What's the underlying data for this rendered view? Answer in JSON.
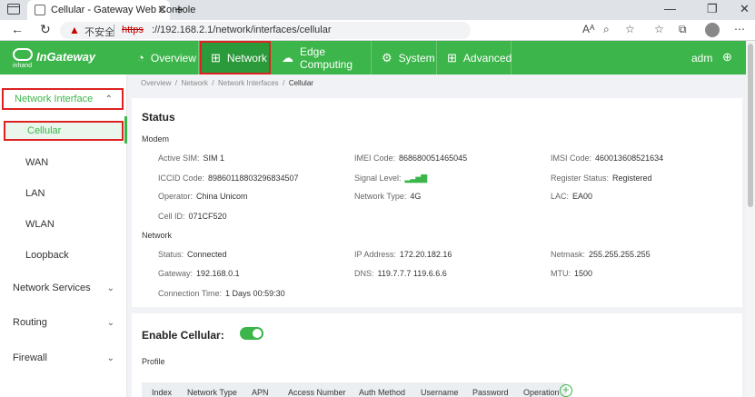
{
  "browser": {
    "tab_title": "Cellular - Gateway Web Console",
    "tab_close": "✕",
    "new_tab": "+",
    "insecure_label": "不安全",
    "url_protocol": "https",
    "url_rest": "://192.168.2.1/network/interfaces/cellular",
    "read_aloud_label": "Aᴬ"
  },
  "header": {
    "brand": "InGateway",
    "brand_sub": "inhand",
    "nav": [
      {
        "label": "Overview",
        "icon": "dashboard-icon"
      },
      {
        "label": "Network",
        "icon": "network-icon"
      },
      {
        "label": "Edge Computing",
        "icon": "cloud-icon"
      },
      {
        "label": "System",
        "icon": "gear-icon"
      },
      {
        "label": "Advanced",
        "icon": "grid-icon"
      }
    ],
    "user": "adm"
  },
  "sidebar": {
    "groups": [
      {
        "label": "Network Interface"
      },
      {
        "label": "Network Services"
      },
      {
        "label": "Routing"
      },
      {
        "label": "Firewall"
      }
    ],
    "subitems": [
      {
        "label": "Cellular"
      },
      {
        "label": "WAN"
      },
      {
        "label": "LAN"
      },
      {
        "label": "WLAN"
      },
      {
        "label": "Loopback"
      }
    ]
  },
  "breadcrumb": {
    "items": [
      "Overview",
      "Network",
      "Network Interfaces",
      "Cellular"
    ],
    "separator": "/"
  },
  "status": {
    "title": "Status",
    "modem_title": "Modem",
    "modem": {
      "active_sim": {
        "label": "Active SIM:",
        "value": "SIM 1"
      },
      "imei": {
        "label": "IMEI Code:",
        "value": "868680051465045"
      },
      "imsi": {
        "label": "IMSI Code:",
        "value": "460013608521634"
      },
      "iccid": {
        "label": "ICCID Code:",
        "value": "89860118803296834507"
      },
      "signal": {
        "label": "Signal Level:",
        "value": ""
      },
      "register": {
        "label": "Register Status:",
        "value": "Registered"
      },
      "operator": {
        "label": "Operator:",
        "value": "China Unicom"
      },
      "network_type": {
        "label": "Network Type:",
        "value": "4G"
      },
      "lac": {
        "label": "LAC:",
        "value": "EA00"
      },
      "cell_id": {
        "label": "Cell ID:",
        "value": "071CF520"
      }
    },
    "network_title": "Network",
    "network": {
      "status": {
        "label": "Status:",
        "value": "Connected"
      },
      "ip": {
        "label": "IP Address:",
        "value": "172.20.182.16"
      },
      "netmask": {
        "label": "Netmask:",
        "value": "255.255.255.255"
      },
      "gateway": {
        "label": "Gateway:",
        "value": "192.168.0.1"
      },
      "dns": {
        "label": "DNS:",
        "value": "119.7.7.7 119.6.6.6"
      },
      "mtu": {
        "label": "MTU:",
        "value": "1500"
      },
      "conn_time": {
        "label": "Connection Time:",
        "value": "1 Days 00:59:30"
      }
    }
  },
  "cellular": {
    "enable_label": "Enable Cellular:",
    "enabled": true,
    "profile_title": "Profile",
    "columns": [
      "Index",
      "Network Type",
      "APN",
      "Access Number",
      "Auth Method",
      "Username",
      "Password",
      "Operation"
    ]
  },
  "colors": {
    "brand_green": "#3cb54a",
    "highlight_red": "#dd2222"
  }
}
